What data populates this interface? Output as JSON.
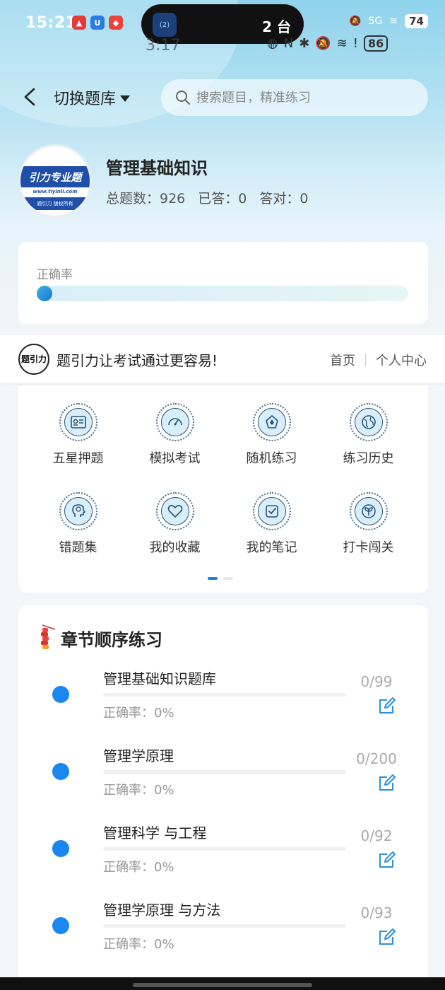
{
  "status_bar": {
    "time": "15:21",
    "island_badge": "2",
    "island_text": "2 台",
    "ghost_time": "3:17",
    "ghost_battery": "86",
    "network": "5G",
    "battery": "74"
  },
  "header": {
    "switch_label": "切换题库",
    "search_placeholder": "搜索题目，精准练习"
  },
  "bank": {
    "logo_text": "引力专业题",
    "logo_url": "www.tiyinli.com",
    "logo_footer": "题引力 版权所有",
    "title": "管理基础知识",
    "total_label": "总题数：926",
    "answered_label": "已答：0",
    "correct_label": "答对：0"
  },
  "accuracy": {
    "label": "正确率",
    "value_fraction": 0
  },
  "banner": {
    "logo_text": "题引力",
    "slogan": "题引力让考试通过更容易!",
    "home": "首页",
    "personal": "个人中心"
  },
  "grid": {
    "items": [
      {
        "label": "五星押题",
        "icon": "id-card-icon"
      },
      {
        "label": "模拟考试",
        "icon": "speedometer-icon"
      },
      {
        "label": "随机练习",
        "icon": "compass-icon"
      },
      {
        "label": "练习历史",
        "icon": "globe-icon"
      },
      {
        "label": "错题集",
        "icon": "brain-head-icon"
      },
      {
        "label": "我的收藏",
        "icon": "heart-icon"
      },
      {
        "label": "我的笔记",
        "icon": "note-check-icon"
      },
      {
        "label": "打卡闯关",
        "icon": "sprout-icon"
      }
    ],
    "page_index": 1,
    "page_count": 2
  },
  "chapters": {
    "title": "章节顺序练习",
    "items": [
      {
        "name": "管理基础知识题库",
        "rate": "正确率：0%",
        "count": "0/99"
      },
      {
        "name": "管理学原理",
        "rate": "正确率：0%",
        "count": "0/200"
      },
      {
        "name": "管理科学 与工程",
        "rate": "正确率：0%",
        "count": "0/92"
      },
      {
        "name": "管理学原理 与方法",
        "rate": "正确率：0%",
        "count": "0/93"
      }
    ]
  },
  "colors": {
    "accent": "#1a86f0",
    "brand": "#1f4fa8"
  }
}
